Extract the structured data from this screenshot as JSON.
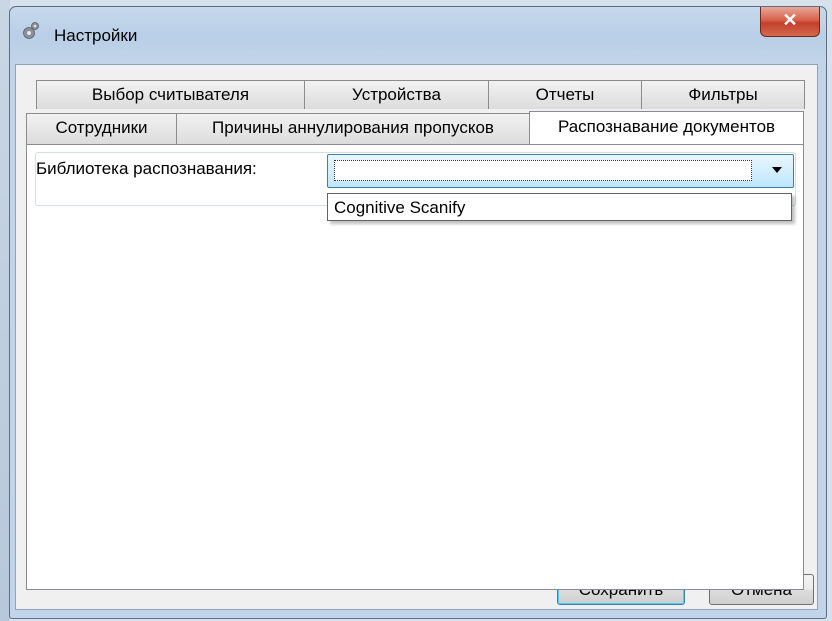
{
  "window": {
    "title": "Настройки",
    "close_glyph": "✕"
  },
  "tabs": {
    "row1": [
      {
        "label": "Выбор считывателя"
      },
      {
        "label": "Устройства"
      },
      {
        "label": "Отчеты"
      },
      {
        "label": "Фильтры"
      }
    ],
    "row2": [
      {
        "label": "Сотрудники"
      },
      {
        "label": "Причины аннулирования пропусков"
      },
      {
        "label": "Распознавание документов",
        "active": true
      }
    ]
  },
  "panel": {
    "library_label": "Библиотека распознавания:",
    "library_value": "",
    "dropdown_options": [
      "Cognitive Scanify"
    ]
  },
  "buttons": {
    "save": "Сохранить",
    "cancel": "Отмена"
  },
  "icons": {
    "app": "gear-icon",
    "close": "close-icon",
    "dropdown": "chevron-down-icon"
  },
  "colors": {
    "close_button": "#c4402a",
    "combo_border": "#3c7fb1",
    "client_bg": "#f0f0f0"
  }
}
